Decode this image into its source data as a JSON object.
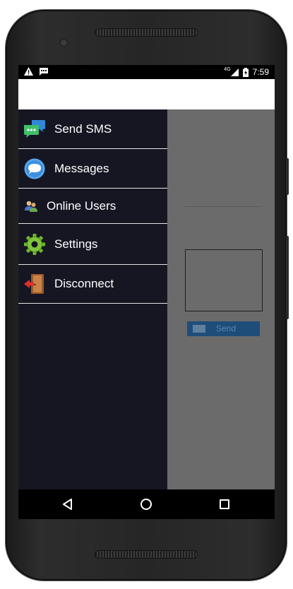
{
  "status_bar": {
    "network": "4G",
    "time": "7:59",
    "icons": [
      "warning-icon",
      "sms-notification-icon",
      "signal-icon",
      "battery-icon"
    ]
  },
  "drawer": {
    "items": [
      {
        "label": "Send SMS",
        "icon": "send-sms-icon"
      },
      {
        "label": "Messages",
        "icon": "messages-icon"
      },
      {
        "label": "Online Users",
        "icon": "online-users-icon"
      },
      {
        "label": "Settings",
        "icon": "settings-icon"
      },
      {
        "label": "Disconnect",
        "icon": "disconnect-icon"
      }
    ]
  },
  "background_form": {
    "send_label": "Send"
  },
  "nav_bar": {
    "icons": [
      "back-icon",
      "home-icon",
      "recents-icon"
    ]
  },
  "colors": {
    "drawer_bg": "#161623",
    "scrim": "#6b6b6b",
    "send_button": "#1f4d7a",
    "separator": "#e6e6e6"
  }
}
